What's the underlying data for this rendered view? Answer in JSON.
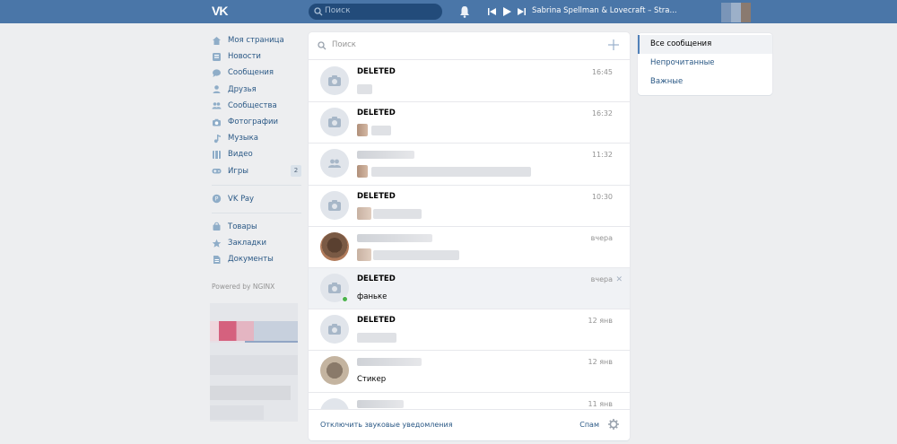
{
  "header": {
    "logo_text": "VK",
    "search_placeholder": "Поиск",
    "track_title": "Sabrina Spellman & Lovecraft – Stra..."
  },
  "nav": {
    "items": [
      {
        "label": "Моя страница",
        "icon": "home-icon"
      },
      {
        "label": "Новости",
        "icon": "news-icon"
      },
      {
        "label": "Сообщения",
        "icon": "messages-icon"
      },
      {
        "label": "Друзья",
        "icon": "friends-icon"
      },
      {
        "label": "Сообщества",
        "icon": "communities-icon"
      },
      {
        "label": "Фотографии",
        "icon": "camera-icon"
      },
      {
        "label": "Музыка",
        "icon": "music-icon"
      },
      {
        "label": "Видео",
        "icon": "video-icon"
      },
      {
        "label": "Игры",
        "icon": "games-icon",
        "badge": "2"
      }
    ],
    "pay_label": "VK Pay",
    "extra_items": [
      {
        "label": "Товары",
        "icon": "goods-icon"
      },
      {
        "label": "Закладки",
        "icon": "bookmarks-icon"
      },
      {
        "label": "Документы",
        "icon": "documents-icon"
      }
    ],
    "powered_by": "Powered by NGINX"
  },
  "panel": {
    "search_placeholder": "Поиск",
    "footer_label": "Отключить звуковые уведомления",
    "spam_label": "Спам"
  },
  "dialogs": [
    {
      "name": "DELETED",
      "time": "16:45",
      "message": ""
    },
    {
      "name": "DELETED",
      "time": "16:32",
      "message": ""
    },
    {
      "name": "",
      "time": "11:32",
      "message": ""
    },
    {
      "name": "DELETED",
      "time": "10:30",
      "message": ""
    },
    {
      "name": "",
      "time": "вчера",
      "message": ""
    },
    {
      "name": "DELETED",
      "time": "вчера",
      "message": "фаньке"
    },
    {
      "name": "DELETED",
      "time": "12 янв",
      "message": ""
    },
    {
      "name": "",
      "time": "12 янв",
      "message": "Стикер"
    },
    {
      "name": "",
      "time": "11 янв",
      "message": ""
    }
  ],
  "right_menu": {
    "items": [
      "Все сообщения",
      "Непрочитанные",
      "Важные"
    ],
    "selected_index": 0
  },
  "colors": {
    "header_bg": "#4a76a8",
    "link": "#2a5885",
    "page_bg": "#edeef0",
    "online": "#4bb34b"
  }
}
